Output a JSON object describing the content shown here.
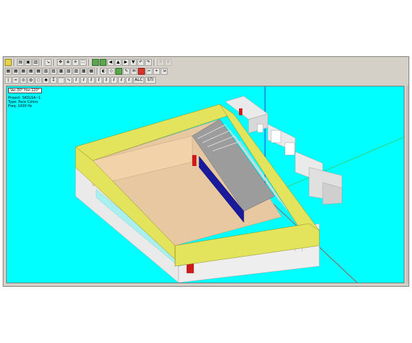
{
  "viewport": {
    "view_angles": "Ver-30°  Hor-120°",
    "project": "Project: SKOLSA~1",
    "display_type": "Type: Face Colors",
    "frequency": "Freq: 1000 Hz",
    "background_color": "#00ffff"
  },
  "toolbar": {
    "row1": [
      "camera-icon",
      "print-icon",
      "copy-icon",
      "arrow-icon",
      "pan-icon",
      "zoom-icon",
      "move-icon",
      "fit-icon",
      "globe-icon",
      "tree-icon",
      "rotate-left-icon",
      "rotate-up-icon",
      "rotate-right-icon",
      "rotate-down-icon",
      "undo-icon",
      "redo-icon",
      "light-icon",
      "scene-icon"
    ],
    "row2": [
      "grid-icon",
      "grid-icon",
      "grid-icon",
      "grid-icon",
      "grid-icon",
      "layer-icon",
      "layer-icon",
      "layer-icon",
      "layer-icon",
      "layer-icon",
      "layer-icon",
      "speaker-icon",
      "select-icon",
      "shape-icon",
      "paint-icon",
      "delete-icon",
      "receiver-icon",
      "erase-icon",
      "measure-icon",
      "cursor-icon"
    ],
    "row3_labels": {
      "sum": "Σ",
      "alc": "ALC",
      "sti": "STI"
    }
  },
  "colors": {
    "roof_edge": "#e4e45c",
    "floor": "#e8c8a0",
    "seating": "#9c9c9c",
    "seating_blue": "#1a1a9c",
    "walls": "#eaeaea",
    "door_red": "#d01a1a",
    "glass": "#a8f0f0",
    "axis_blue": "#3030d0",
    "axis_green": "#30d080",
    "axis_red": "#c03030"
  }
}
